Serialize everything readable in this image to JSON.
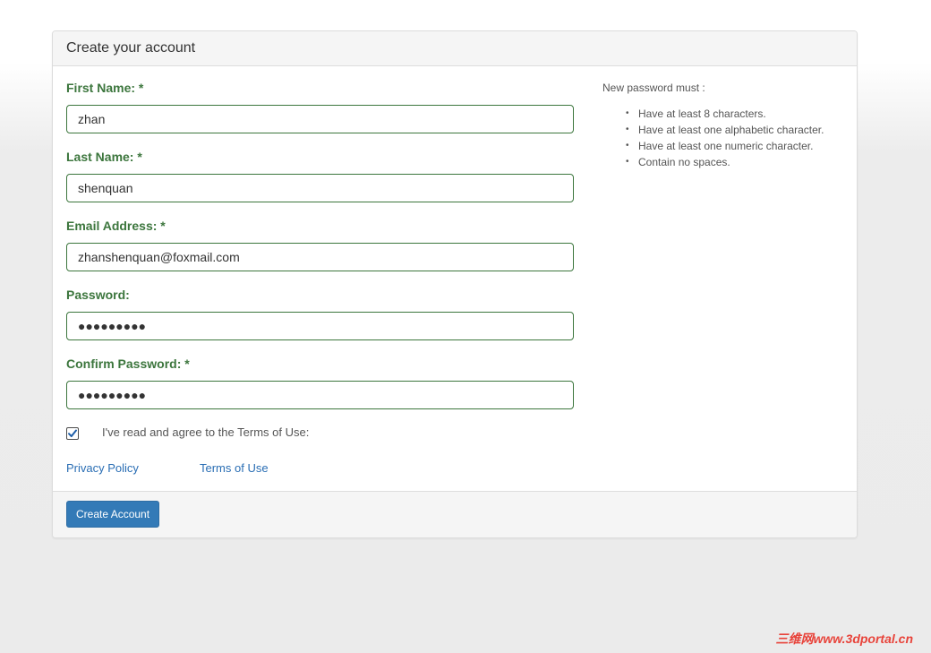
{
  "panel": {
    "title": "Create your account"
  },
  "form": {
    "first_name": {
      "label": "First Name: *",
      "value": "zhan"
    },
    "last_name": {
      "label": "Last Name: *",
      "value": "shenquan"
    },
    "email": {
      "label": "Email Address: *",
      "value": "zhanshenquan@foxmail.com"
    },
    "password": {
      "label": "Password:",
      "value": "●●●●●●●●●"
    },
    "confirm_password": {
      "label": "Confirm Password: *",
      "value": "●●●●●●●●●"
    },
    "terms_checkbox": {
      "checked": true,
      "label": "I've read and agree to the Terms of Use:"
    },
    "links": {
      "privacy": "Privacy Policy",
      "terms": "Terms of Use"
    }
  },
  "password_rules": {
    "title": "New password must :",
    "items": [
      "Have at least 8 characters.",
      "Have at least one alphabetic character.",
      "Have at least one numeric character.",
      "Contain no spaces."
    ]
  },
  "footer": {
    "submit_label": "Create Account"
  },
  "watermark": "三维网www.3dportal.cn",
  "colors": {
    "label_green": "#3c763d",
    "link_blue": "#2a6eb4",
    "button_blue": "#337ab7",
    "watermark_red": "#e8433a"
  }
}
